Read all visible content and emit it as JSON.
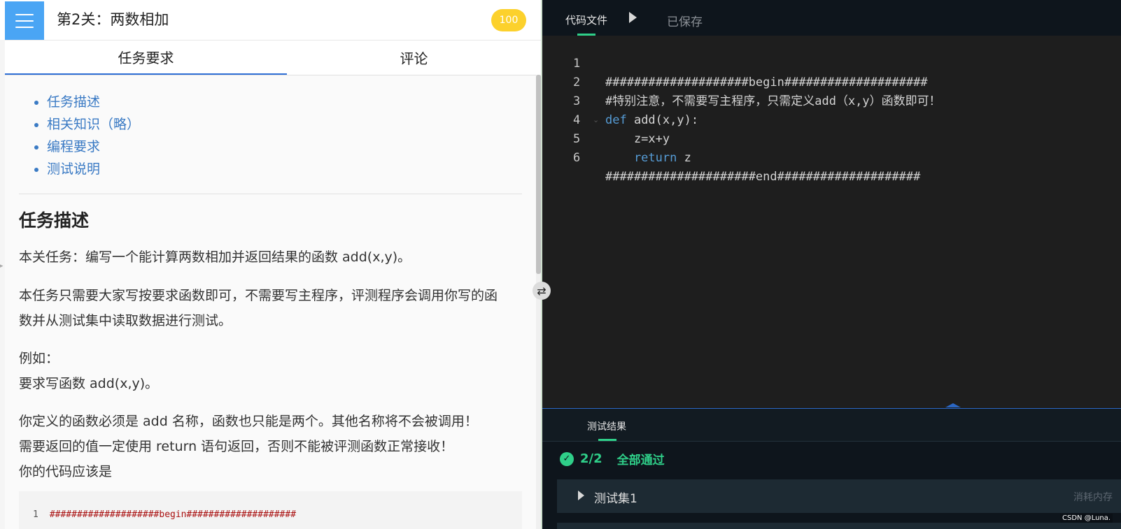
{
  "header": {
    "level_title": "第2关：两数相加",
    "score": "100"
  },
  "tabs": [
    {
      "label": "任务要求"
    },
    {
      "label": "评论"
    }
  ],
  "toc": [
    {
      "label": "任务描述"
    },
    {
      "label": "相关知识（略）"
    },
    {
      "label": "编程要求"
    },
    {
      "label": "测试说明"
    }
  ],
  "content": {
    "section_heading": "任务描述",
    "paragraphs": [
      "本关任务：编写一个能计算两数相加并返回结果的函数 add(x,y)。",
      "本任务只需要大家写按要求函数即可，不需要写主程序，评测程序会调用你写的函数并从测试集中读取数据进行测试。",
      "例如：\n要求写函数 add(x,y)。",
      "你定义的函数必须是 add 名称，函数也只能是两个。其他名称将不会被调用！\n需要返回的值一定使用 return 语句返回，否则不能被评测函数正常接收！\n你的代码应该是"
    ],
    "code_sample": {
      "line_number": "1",
      "text": "####################begin####################"
    }
  },
  "editor": {
    "file_tab": "代码文件",
    "saved_status": "已保存",
    "lines": [
      {
        "num": "1",
        "text": "####################begin####################",
        "kind": "comment"
      },
      {
        "num": "2",
        "text": "#特别注意，不需要写主程序，只需定义add（x,y）函数即可！",
        "kind": "comment"
      },
      {
        "num": "3",
        "kw": "def",
        "text": " add(x,y):",
        "kind": "def"
      },
      {
        "num": "4",
        "text": "    z=x+y",
        "kind": "plain"
      },
      {
        "num": "5",
        "kw": "    return",
        "text": " z",
        "kind": "return"
      },
      {
        "num": "6",
        "text": "#####################end####################",
        "kind": "comment"
      }
    ]
  },
  "results": {
    "tab": "测试结果",
    "pass_count": "2/2",
    "pass_text": "全部通过",
    "testsets": [
      {
        "label": "测试集1",
        "meta": "消耗内存"
      }
    ]
  },
  "watermark": "CSDN @Luna.",
  "colors": {
    "accent_green": "#2fcf89",
    "menu_blue": "#4aa5f4",
    "badge_yellow": "#fcd12c",
    "link_blue": "#3a7ac4",
    "editor_bg": "#1e1e1e",
    "comment_green": "#4f9a45",
    "keyword_blue": "#569cd6"
  },
  "icons": {
    "menu": "hamburger-menu-icon",
    "run": "play-icon",
    "resize": "swap-horizontal-icon",
    "split": "double-chevron-icon",
    "pass": "check-circle-icon",
    "expand": "caret-right-icon"
  }
}
